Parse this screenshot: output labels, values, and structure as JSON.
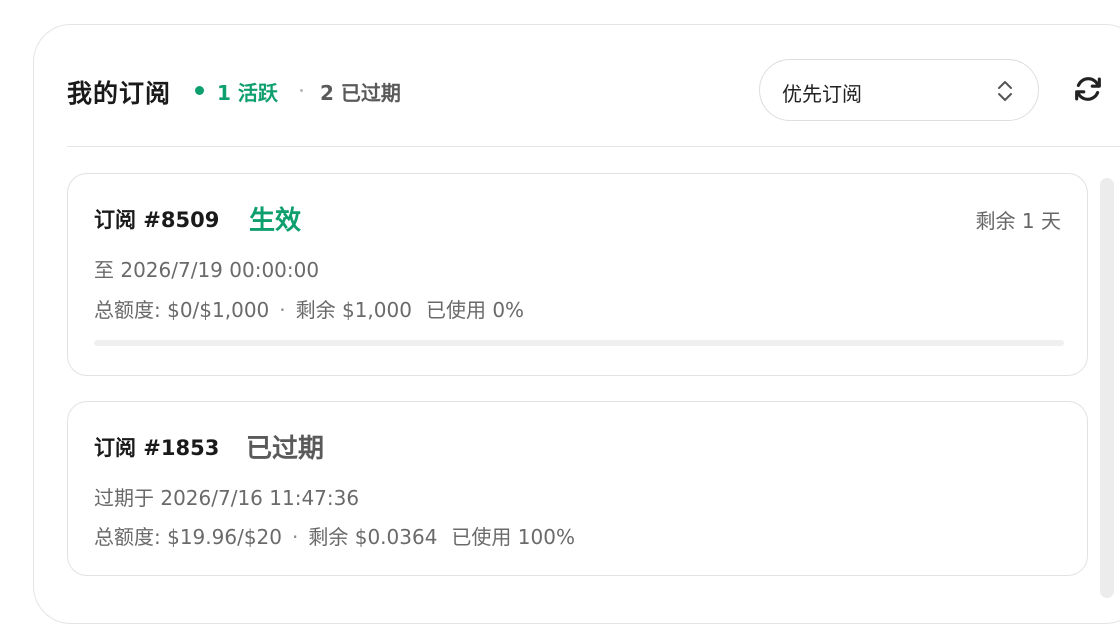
{
  "header": {
    "title": "我的订阅",
    "active_label": "1 活跃",
    "expired_label": "2 已过期",
    "sort_select": {
      "value": "优先订阅"
    }
  },
  "subscriptions": [
    {
      "title": "订阅 #8509",
      "status": "生效",
      "remaining_time": "剩余 1 天",
      "date_line": "至 2026/7/19 00:00:00",
      "quota_label": "总额度: $0/$1,000",
      "dot": "·",
      "remaining_amount": "剩余 $1,000",
      "used": "已使用 0%",
      "usage_fraction": 0
    },
    {
      "title": "订阅 #1853",
      "status": "已过期",
      "date_line": "过期于 2026/7/16 11:47:36",
      "quota_label": "总额度: $19.96/$20",
      "dot": "·",
      "remaining_amount": "剩余 $0.0364",
      "used": "已使用 100%"
    }
  ],
  "colors": {
    "active": "#0e9f6e",
    "muted": "#5a5a5a",
    "border": "#e2e2e2"
  },
  "icons": {
    "select": "chevron-up-down-icon",
    "refresh": "refresh-icon"
  }
}
